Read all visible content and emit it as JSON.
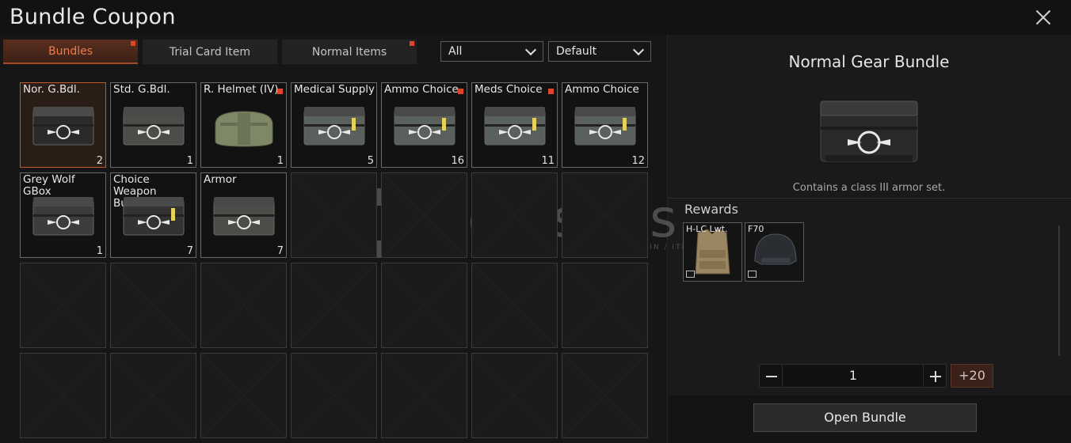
{
  "title": "Bundle Coupon",
  "tabs": [
    {
      "label": "Bundles",
      "active": true,
      "dot": true
    },
    {
      "label": "Trial Card Item",
      "active": false,
      "dot": false
    },
    {
      "label": "Normal Items",
      "active": false,
      "dot": true
    }
  ],
  "filters": {
    "category": "All",
    "sort": "Default"
  },
  "items": [
    {
      "name": "Nor. G.Bdl.",
      "count": "2",
      "icon": "black-crate-icon",
      "dot": false
    },
    {
      "name": "Std. G.Bdl.",
      "count": "1",
      "icon": "camo-crate-icon",
      "dot": false
    },
    {
      "name": "R. Helmet (IV)",
      "count": "1",
      "icon": "green-bag-icon",
      "dot": true
    },
    {
      "name": "Medical Supply",
      "count": "5",
      "icon": "medical-crate-icon",
      "dot": false
    },
    {
      "name": "Ammo Choice",
      "count": "16",
      "icon": "ammo-crate-icon",
      "dot": true
    },
    {
      "name": "Meds Choice",
      "count": "11",
      "icon": "meds-crate-icon",
      "dot": true
    },
    {
      "name": "Ammo Choice",
      "count": "12",
      "icon": "ammo-crate-icon",
      "dot": false
    },
    {
      "name": "Grey Wolf GBox",
      "count": "1",
      "icon": "grey-crate-icon",
      "dot": false
    },
    {
      "name": "Choice Weapon Bundle",
      "count": "7",
      "icon": "weapon-crate-icon",
      "dot": false
    },
    {
      "name": "Armor",
      "count": "7",
      "icon": "camo-crate-icon",
      "dot": false
    }
  ],
  "detail": {
    "title": "Normal Gear Bundle",
    "description": "Contains a class III armor set.",
    "rewards_label": "Rewards",
    "rewards": [
      {
        "name": "H-LC Lwt.",
        "icon": "vest-icon"
      },
      {
        "name": "F70",
        "icon": "helmet-icon"
      }
    ],
    "quantity": "1",
    "plus_label": "+20",
    "open_label": "Open Bundle"
  },
  "watermark": {
    "text": "itemsatis",
    "sub": "HESAP / SKIN / ITEM / ...COM"
  },
  "colors": {
    "accent": "#e0452b",
    "tab_active": "#f07a4a",
    "background": "#121212"
  }
}
